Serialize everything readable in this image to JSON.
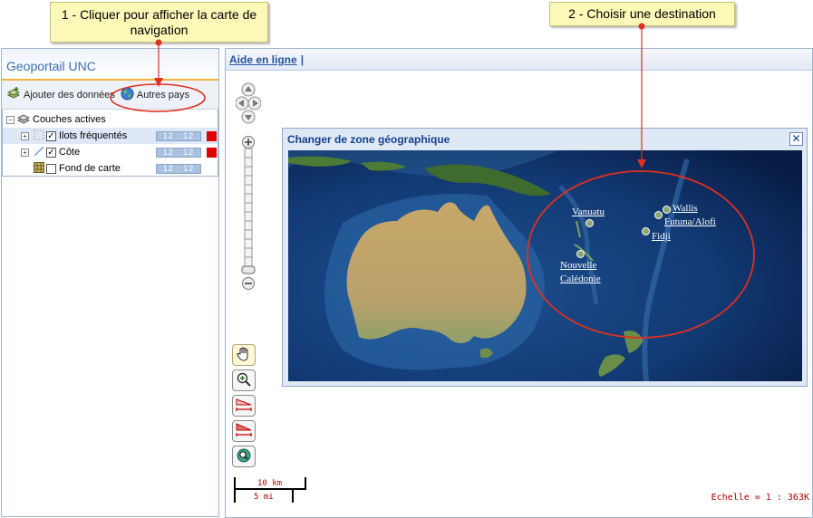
{
  "callouts": {
    "step1": "1 - Cliquer pour afficher la carte de navigation",
    "step2": "2 - Choisir une destination"
  },
  "left_panel": {
    "title": "Geoportail UNC",
    "toolbar": {
      "add_data_label": "Ajouter des données",
      "other_countries_label": "Autres pays"
    },
    "layers_root": "Couches actives",
    "layers": [
      {
        "name": "Ilots fréquentés",
        "checked": true,
        "opacity": "12 : 12",
        "color": "#e00000"
      },
      {
        "name": "Côte",
        "checked": true,
        "opacity": "12 : 12",
        "color": "#e00000"
      },
      {
        "name": "Fond de carte",
        "checked": false,
        "opacity": "12 : 12"
      }
    ]
  },
  "map": {
    "header_link": "Aide en ligne",
    "header_sep": "|",
    "scale_top": "10 km",
    "scale_bottom": "5 mi",
    "echelle": "Echelle = 1 : 363K"
  },
  "dialog": {
    "title": "Changer de zone géographique",
    "close_label": "✕",
    "destinations": {
      "vanuatu": "Vanuatu",
      "wallis": "Wallis",
      "futuna": "Futuna/Alofi",
      "fidji": "Fidji",
      "nc_line1": "Nouvelle",
      "nc_line2": "Calédonie"
    }
  },
  "colors": {
    "accent": "#3b6eb5",
    "highlight_ellipse": "#e03020",
    "ocean_deep": "#0a1f4e",
    "land": "#b5a56a"
  },
  "icons": [
    "add-data-icon",
    "globe-icon",
    "layers-icon",
    "pan-hand-icon",
    "zoom-in-icon",
    "measure-distance-icon",
    "measure-area-icon",
    "zoom-extent-icon",
    "close-icon"
  ]
}
